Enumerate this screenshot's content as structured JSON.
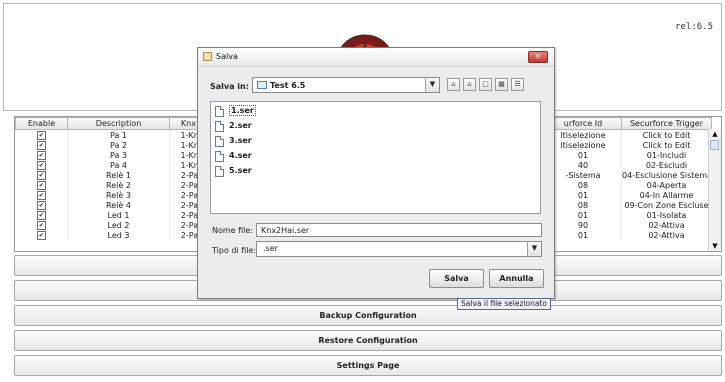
{
  "header": {
    "release": "rel:6.5"
  },
  "table": {
    "columns": [
      "Enable",
      "Description",
      "Knx F",
      "",
      "",
      "",
      "urforce Id",
      "Securforce Trigger"
    ],
    "rows": [
      {
        "enabled": "✔",
        "desc": "Pa 1",
        "knx": "1-Knx",
        "sid": "ltiselezione",
        "trig": "Click to Edit"
      },
      {
        "enabled": "✔",
        "desc": "Pa 2",
        "knx": "1-Knx",
        "sid": "ltiselezione",
        "trig": "Click to Edit"
      },
      {
        "enabled": "✔",
        "desc": "Pa 3",
        "knx": "1-Knx",
        "sid": "01",
        "trig": "01-Includi"
      },
      {
        "enabled": "✔",
        "desc": "Pa 4",
        "knx": "1-Knx",
        "sid": "40",
        "trig": "02-Escludi"
      },
      {
        "enabled": "✔",
        "desc": "Relè 1",
        "knx": "2-Pan",
        "sid": "-Sistema",
        "trig": "04-Esclusione Sistema"
      },
      {
        "enabled": "✔",
        "desc": "Relè 2",
        "knx": "2-Pan",
        "sid": "08",
        "trig": "04-Aperta"
      },
      {
        "enabled": "✔",
        "desc": "Relè 3",
        "knx": "2-Pan",
        "sid": "01",
        "trig": "04-In Allarme"
      },
      {
        "enabled": "✔",
        "desc": "Relè 4",
        "knx": "2-Pan",
        "sid": "08",
        "trig": "09-Con Zone Escluse"
      },
      {
        "enabled": "✔",
        "desc": "Led 1",
        "knx": "2-Pan",
        "sid": "01",
        "trig": "01-Isolata"
      },
      {
        "enabled": "✔",
        "desc": "Led 2",
        "knx": "2-Pan",
        "sid": "90",
        "trig": "02-Attiva"
      },
      {
        "enabled": "✔",
        "desc": "Led 3",
        "knx": "2-Pan",
        "sid": "01",
        "trig": "02-Attiva"
      }
    ],
    "scroll_up": "▲",
    "scroll_down": "▼"
  },
  "buttons": {
    "backup": "Backup Configuration",
    "restore": "Restore Configuration",
    "settings": "Settings Page"
  },
  "dialog": {
    "title": "Salva",
    "close": "✕",
    "save_in_label": "Salva in:",
    "folder": "Test 6.5",
    "toolbar_icons": [
      "up-folder-icon",
      "home-icon",
      "new-folder-icon",
      "list-view-icon",
      "details-view-icon"
    ],
    "files": [
      "1.ser",
      "2.ser",
      "3.ser",
      "4.ser",
      "5.ser"
    ],
    "filename_label": "Nome file:",
    "filename_value": "Knx2Hai.ser",
    "filetype_label": "Tipo di file:",
    "filetype_value": ".ser",
    "save_button": "Salva",
    "cancel_button": "Annulla",
    "tooltip": "Salva il file selezionato"
  }
}
